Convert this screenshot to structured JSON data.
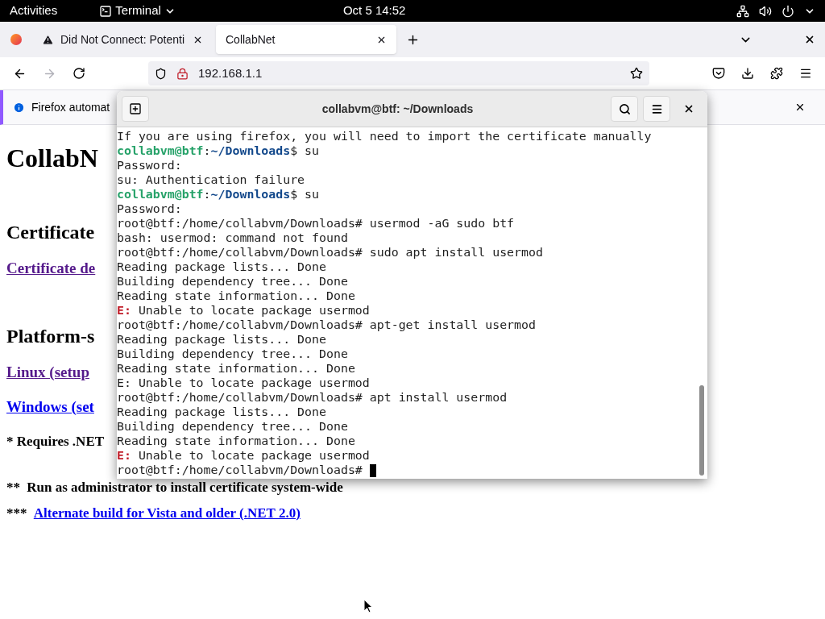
{
  "top_bar": {
    "activities": "Activities",
    "app": "Terminal",
    "clock": "Oct 5  14:52"
  },
  "browser": {
    "tabs": [
      {
        "label": "Did Not Connect: Potenti",
        "selected": false,
        "warning": true
      },
      {
        "label": "CollabNet",
        "selected": true,
        "warning": false
      }
    ],
    "address": "192.168.1.1",
    "info_bar": "Firefox automat",
    "page": {
      "title": "CollabN",
      "sections": [
        {
          "kind": "h2",
          "text": "Certificate"
        },
        {
          "kind": "link",
          "text": "Certificate de",
          "visited": true
        },
        {
          "kind": "h2",
          "text": "Platform-s"
        },
        {
          "kind": "link",
          "text": "Linux (setup",
          "visited": true
        },
        {
          "kind": "link",
          "text": "Windows (set",
          "visited": false
        },
        {
          "kind": "note",
          "text": "* Requires .NET"
        }
      ],
      "footnotes": [
        {
          "prefix": "** ",
          "text": "Run as administrator to install certificate system-wide",
          "link": false
        },
        {
          "prefix": "*** ",
          "text": "Alternate build for Vista and older (.NET 2.0)",
          "link": true
        }
      ]
    }
  },
  "terminal": {
    "title": "collabvm@btf: ~/Downloads",
    "lines": [
      [
        {
          "kind": "plain",
          "text": "If you are using firefox, you will need to import the certificate manually"
        }
      ],
      [
        {
          "kind": "user",
          "text": "collabvm@btf"
        },
        {
          "kind": "plain",
          "text": ":"
        },
        {
          "kind": "path",
          "text": "~/Downloads"
        },
        {
          "kind": "plain",
          "text": "$ su"
        }
      ],
      [
        {
          "kind": "plain",
          "text": "Password:"
        }
      ],
      [
        {
          "kind": "plain",
          "text": "su: Authentication failure"
        }
      ],
      [
        {
          "kind": "user",
          "text": "collabvm@btf"
        },
        {
          "kind": "plain",
          "text": ":"
        },
        {
          "kind": "path",
          "text": "~/Downloads"
        },
        {
          "kind": "plain",
          "text": "$ su"
        }
      ],
      [
        {
          "kind": "plain",
          "text": "Password:"
        }
      ],
      [
        {
          "kind": "plain",
          "text": "root@btf:/home/collabvm/Downloads# usermod -aG sudo btf"
        }
      ],
      [
        {
          "kind": "plain",
          "text": "bash: usermod: command not found"
        }
      ],
      [
        {
          "kind": "plain",
          "text": "root@btf:/home/collabvm/Downloads# sudo apt install usermod"
        }
      ],
      [
        {
          "kind": "plain",
          "text": "Reading package lists... Done"
        }
      ],
      [
        {
          "kind": "plain",
          "text": "Building dependency tree... Done"
        }
      ],
      [
        {
          "kind": "plain",
          "text": "Reading state information... Done"
        }
      ],
      [
        {
          "kind": "error",
          "text": "E:"
        },
        {
          "kind": "plain",
          "text": " Unable to locate package usermod"
        }
      ],
      [
        {
          "kind": "plain",
          "text": "root@btf:/home/collabvm/Downloads# apt-get install usermod"
        }
      ],
      [
        {
          "kind": "plain",
          "text": "Reading package lists... Done"
        }
      ],
      [
        {
          "kind": "plain",
          "text": "Building dependency tree... Done"
        }
      ],
      [
        {
          "kind": "plain",
          "text": "Reading state information... Done"
        }
      ],
      [
        {
          "kind": "plain",
          "text": "E: Unable to locate package usermod"
        }
      ],
      [
        {
          "kind": "plain",
          "text": "root@btf:/home/collabvm/Downloads# apt install usermod"
        }
      ],
      [
        {
          "kind": "plain",
          "text": "Reading package lists... Done"
        }
      ],
      [
        {
          "kind": "plain",
          "text": "Building dependency tree... Done"
        }
      ],
      [
        {
          "kind": "plain",
          "text": "Reading state information... Done"
        }
      ],
      [
        {
          "kind": "error",
          "text": "E:"
        },
        {
          "kind": "plain",
          "text": " Unable to locate package usermod"
        }
      ],
      [
        {
          "kind": "plain",
          "text": "root@btf:/home/collabvm/Downloads# "
        },
        {
          "kind": "cursor"
        }
      ]
    ]
  }
}
